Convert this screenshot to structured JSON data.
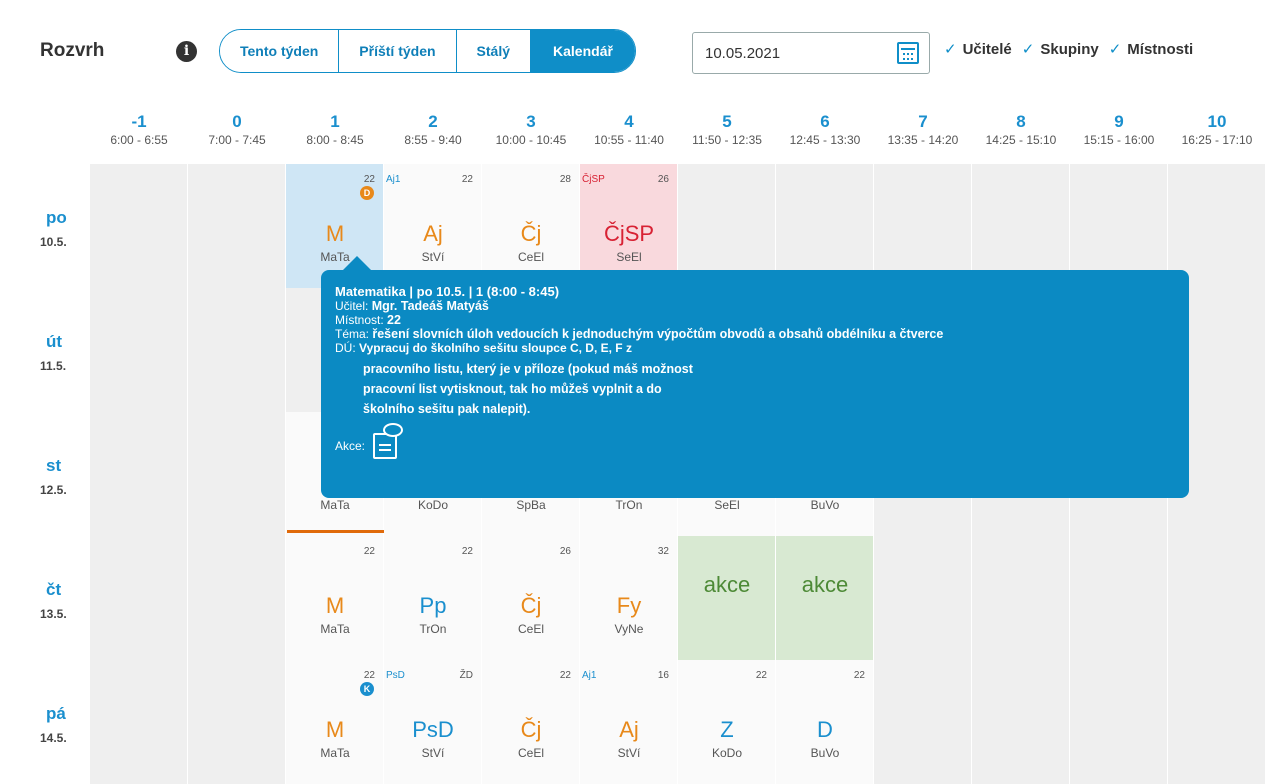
{
  "toolbar": {
    "title": "Rozvrh",
    "tabs": [
      "Tento týden",
      "Příští týden",
      "Stálý",
      "Kalendář"
    ],
    "active_tab": "Kalendář",
    "date_value": "10.05.2021",
    "filters": [
      "Učitelé",
      "Skupiny",
      "Místnosti"
    ]
  },
  "hours": [
    {
      "num": "-1",
      "time": "6:00 - 6:55"
    },
    {
      "num": "0",
      "time": "7:00 - 7:45"
    },
    {
      "num": "1",
      "time": "8:00 - 8:45"
    },
    {
      "num": "2",
      "time": "8:55 - 9:40"
    },
    {
      "num": "3",
      "time": "10:00 - 10:45"
    },
    {
      "num": "4",
      "time": "10:55 - 11:40"
    },
    {
      "num": "5",
      "time": "11:50 - 12:35"
    },
    {
      "num": "6",
      "time": "12:45 - 13:30"
    },
    {
      "num": "7",
      "time": "13:35 - 14:20"
    },
    {
      "num": "8",
      "time": "14:25 - 15:10"
    },
    {
      "num": "9",
      "time": "15:15 - 16:00"
    },
    {
      "num": "10",
      "time": "16:25 - 17:10"
    }
  ],
  "days": [
    {
      "name": "po",
      "date": "10.5.",
      "lessons": [
        {
          "col": 2,
          "subject": "M",
          "teacher": "MaTa",
          "room": "22",
          "badge": "D",
          "style": "sel"
        },
        {
          "col": 3,
          "subject": "Aj",
          "teacher": "StVí",
          "room": "22",
          "group": "Aj1"
        },
        {
          "col": 4,
          "subject": "Čj",
          "teacher": "CeEl",
          "room": "28"
        },
        {
          "col": 5,
          "subject": "ČjSP",
          "teacher": "SeEl",
          "room": "26",
          "group": "ČjSP",
          "style": "red"
        }
      ]
    },
    {
      "name": "út",
      "date": "11.5.",
      "lessons": []
    },
    {
      "name": "st",
      "date": "12.5.",
      "lessons": [
        {
          "col": 2,
          "subject": "",
          "teacher": "MaTa"
        },
        {
          "col": 3,
          "subject": "",
          "teacher": "KoDo"
        },
        {
          "col": 4,
          "subject": "",
          "teacher": "SpBa"
        },
        {
          "col": 5,
          "subject": "",
          "teacher": "TrOn"
        },
        {
          "col": 6,
          "subject": "",
          "teacher": "SeEl"
        },
        {
          "col": 7,
          "subject": "",
          "teacher": "BuVo"
        }
      ]
    },
    {
      "name": "čt",
      "date": "13.5.",
      "lessons": [
        {
          "col": 2,
          "subject": "M",
          "teacher": "MaTa",
          "room": "22"
        },
        {
          "col": 3,
          "subject": "Pp",
          "teacher": "TrOn",
          "room": "22",
          "color": "b"
        },
        {
          "col": 4,
          "subject": "Čj",
          "teacher": "CeEl",
          "room": "26"
        },
        {
          "col": 5,
          "subject": "Fy",
          "teacher": "VyNe",
          "room": "32"
        },
        {
          "col": 6,
          "subject": "akce",
          "teacher": "",
          "style": "grn",
          "color": "g"
        },
        {
          "col": 7,
          "subject": "akce",
          "teacher": "",
          "style": "grn",
          "color": "g"
        }
      ]
    },
    {
      "name": "pá",
      "date": "14.5.",
      "lessons": [
        {
          "col": 2,
          "subject": "M",
          "teacher": "MaTa",
          "room": "22",
          "badge": "K"
        },
        {
          "col": 3,
          "subject": "PsD",
          "teacher": "StVí",
          "room": "ŽD",
          "group": "PsD",
          "color": "b"
        },
        {
          "col": 4,
          "subject": "Čj",
          "teacher": "CeEl",
          "room": "22"
        },
        {
          "col": 5,
          "subject": "Aj",
          "teacher": "StVí",
          "room": "16",
          "group": "Aj1"
        },
        {
          "col": 6,
          "subject": "Z",
          "teacher": "KoDo",
          "room": "22",
          "color": "b"
        },
        {
          "col": 7,
          "subject": "D",
          "teacher": "BuVo",
          "room": "22",
          "color": "b"
        }
      ]
    }
  ],
  "tooltip": {
    "heading": "Matematika | po 10.5. | 1 (8:00 - 8:45)",
    "teacher_label": "Učitel:",
    "teacher_value": "Mgr. Tadeáš Matyáš",
    "room_label": "Místnost:",
    "room_value": "22",
    "topic_label": "Téma:",
    "topic_value": "řešení slovních úloh vedoucích k jednoduchým výpočtům obvodů a obsahů obdélníku a čtverce",
    "hw_label": "DÚ:",
    "hw_lines": [
      "Vypracuj do školního sešitu sloupce C, D, E, F z",
      "pracovního listu, který je v příloze (pokud máš možnost",
      "pracovní list vytisknout, tak ho můžeš vyplnit a do",
      "školního sešitu pak nalepit)."
    ],
    "actions_label": "Akce:"
  },
  "colors": {
    "accent": "#0f8ec8",
    "tooltip": "#0b8ac3",
    "subject": "#e8891a",
    "event": "#4d8a36"
  }
}
